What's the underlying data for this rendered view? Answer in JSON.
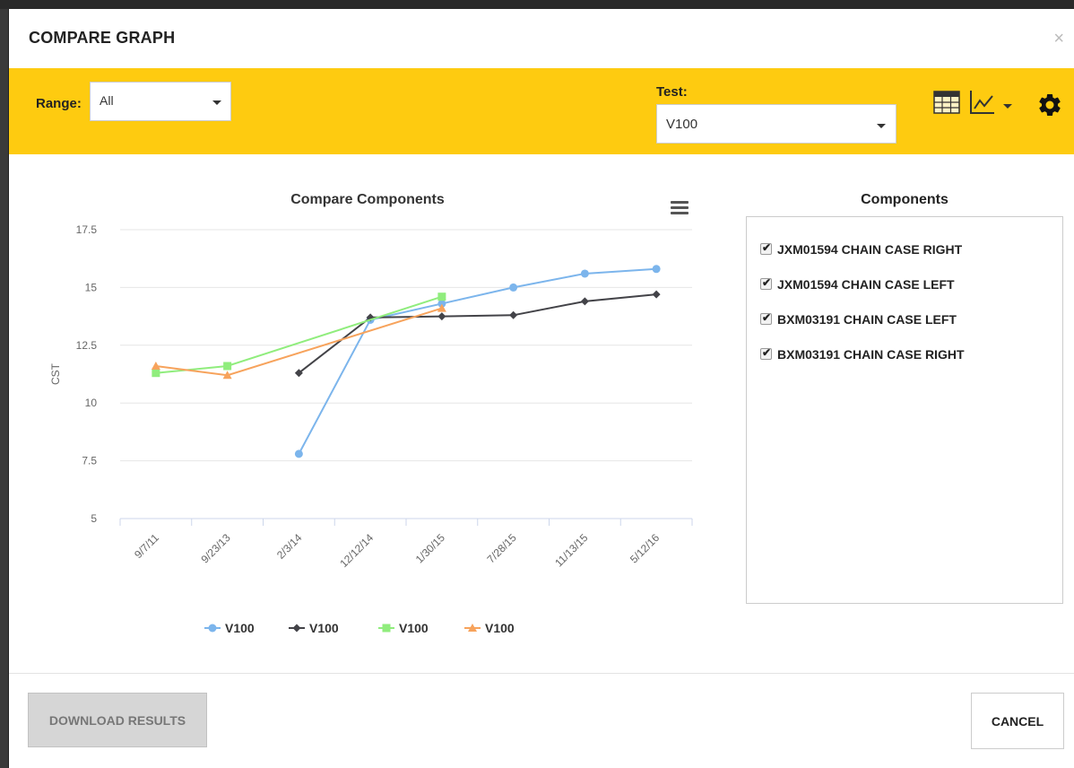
{
  "modal": {
    "title": "COMPARE GRAPH",
    "close": "×"
  },
  "toolbar": {
    "range_label": "Range:",
    "range_value": "All",
    "test_label": "Test:",
    "test_value": "V100",
    "icons": [
      "table-icon",
      "line-chart-icon",
      "chevron-down-icon",
      "gear-icon"
    ]
  },
  "chart_data": {
    "type": "line",
    "title": "Compare Components",
    "ylabel": "CST",
    "xlabel": "",
    "categories": [
      "9/7/11",
      "9/23/13",
      "2/3/14",
      "12/12/14",
      "1/30/15",
      "7/28/15",
      "11/13/15",
      "5/12/16"
    ],
    "ylim": [
      5,
      17.5
    ],
    "yticks": [
      "5",
      "7.5",
      "10",
      "12.5",
      "15",
      "17.5"
    ],
    "grid": true,
    "legend_position": "bottom",
    "series": [
      {
        "name": "V100",
        "color": "#7cb5ec",
        "marker": "circle",
        "values": [
          null,
          null,
          7.8,
          13.6,
          14.3,
          15.0,
          15.6,
          15.8
        ]
      },
      {
        "name": "V100",
        "color": "#434348",
        "marker": "diamond",
        "values": [
          null,
          null,
          11.3,
          13.7,
          13.75,
          13.8,
          14.4,
          14.7
        ]
      },
      {
        "name": "V100",
        "color": "#90ed7d",
        "marker": "square",
        "values": [
          11.3,
          11.6,
          null,
          null,
          14.6,
          null,
          null,
          null
        ]
      },
      {
        "name": "V100",
        "color": "#f7a35c",
        "marker": "triangle",
        "values": [
          11.6,
          11.2,
          null,
          null,
          14.1,
          null,
          null,
          null
        ]
      }
    ]
  },
  "components": {
    "title": "Components",
    "items": [
      {
        "label": "JXM01594 CHAIN CASE RIGHT",
        "checked": true
      },
      {
        "label": "JXM01594 CHAIN CASE LEFT",
        "checked": true
      },
      {
        "label": "BXM03191 CHAIN CASE LEFT",
        "checked": true
      },
      {
        "label": "BXM03191 CHAIN CASE RIGHT",
        "checked": true
      }
    ]
  },
  "footer": {
    "download_label": "DOWNLOAD RESULTS",
    "cancel_label": "CANCEL"
  }
}
